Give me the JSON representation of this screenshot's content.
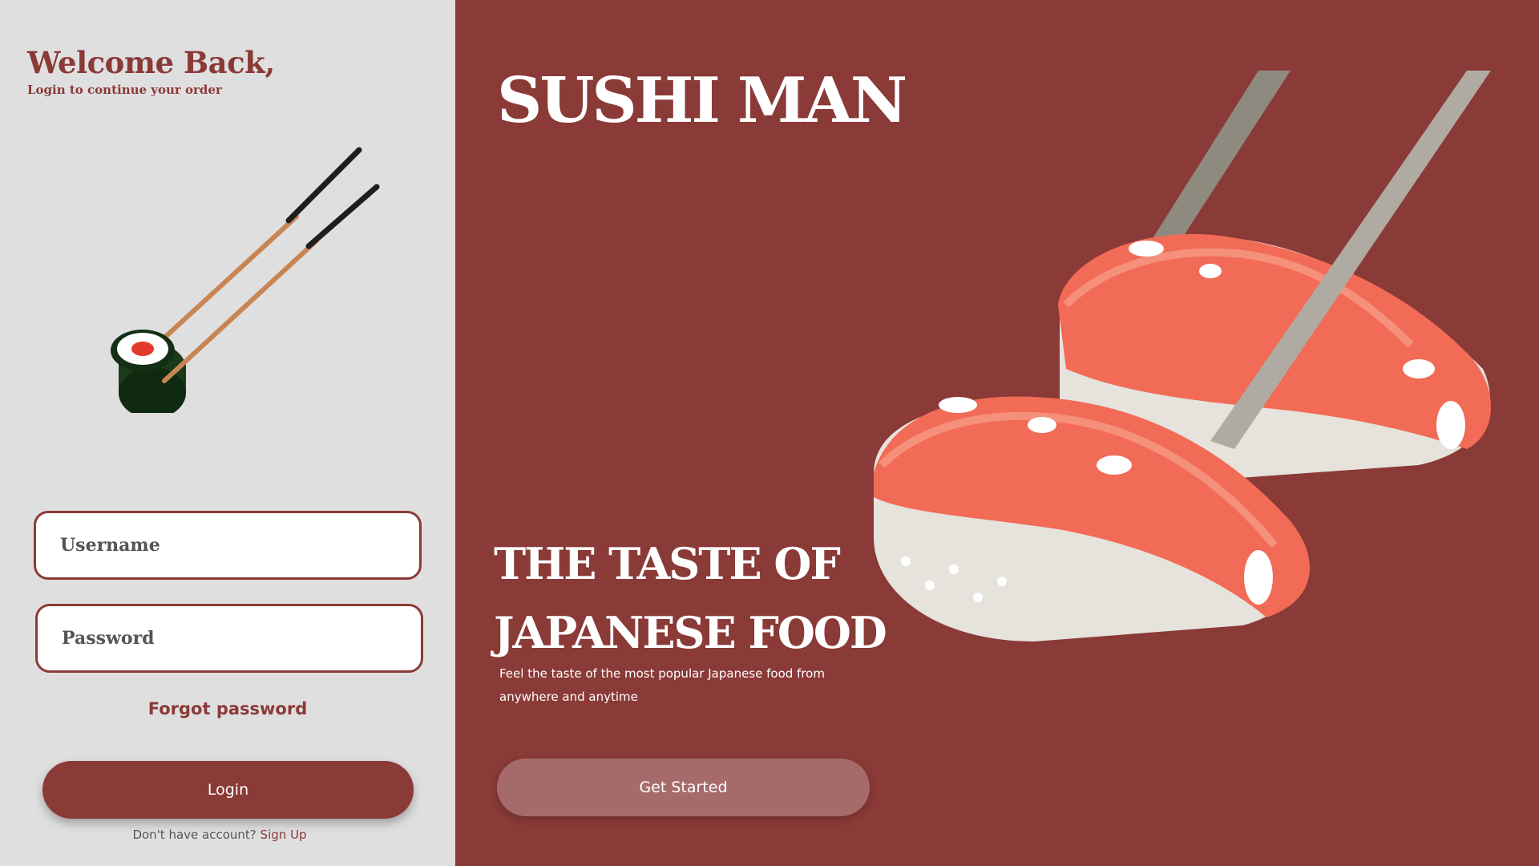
{
  "login": {
    "title": "Welcome Back,",
    "subtitle": "Login to continue your order",
    "username_placeholder": "Username",
    "password_placeholder": "Password",
    "forgot_label": "Forgot password",
    "login_label": "Login",
    "signup_prompt": "Don't have account?",
    "signup_link": "Sign Up"
  },
  "hero": {
    "brand": "SUSHI MAN",
    "tagline_line1": "THE TASTE OF",
    "tagline_line2": "JAPANESE FOOD",
    "description": "Feel the taste of the most popular Japanese food from anywhere and anytime",
    "cta_label": "Get Started"
  },
  "icons": {
    "roll": "sushi-roll-chopsticks-illustration",
    "nigiri": "salmon-nigiri-chopsticks-illustration"
  },
  "colors": {
    "brand": "#8a3a37",
    "left_panel_bg": "#e0dfdf",
    "cta_bg": "#a56b6a",
    "salmon": "#f26b56",
    "rice": "#e6e2dc"
  }
}
